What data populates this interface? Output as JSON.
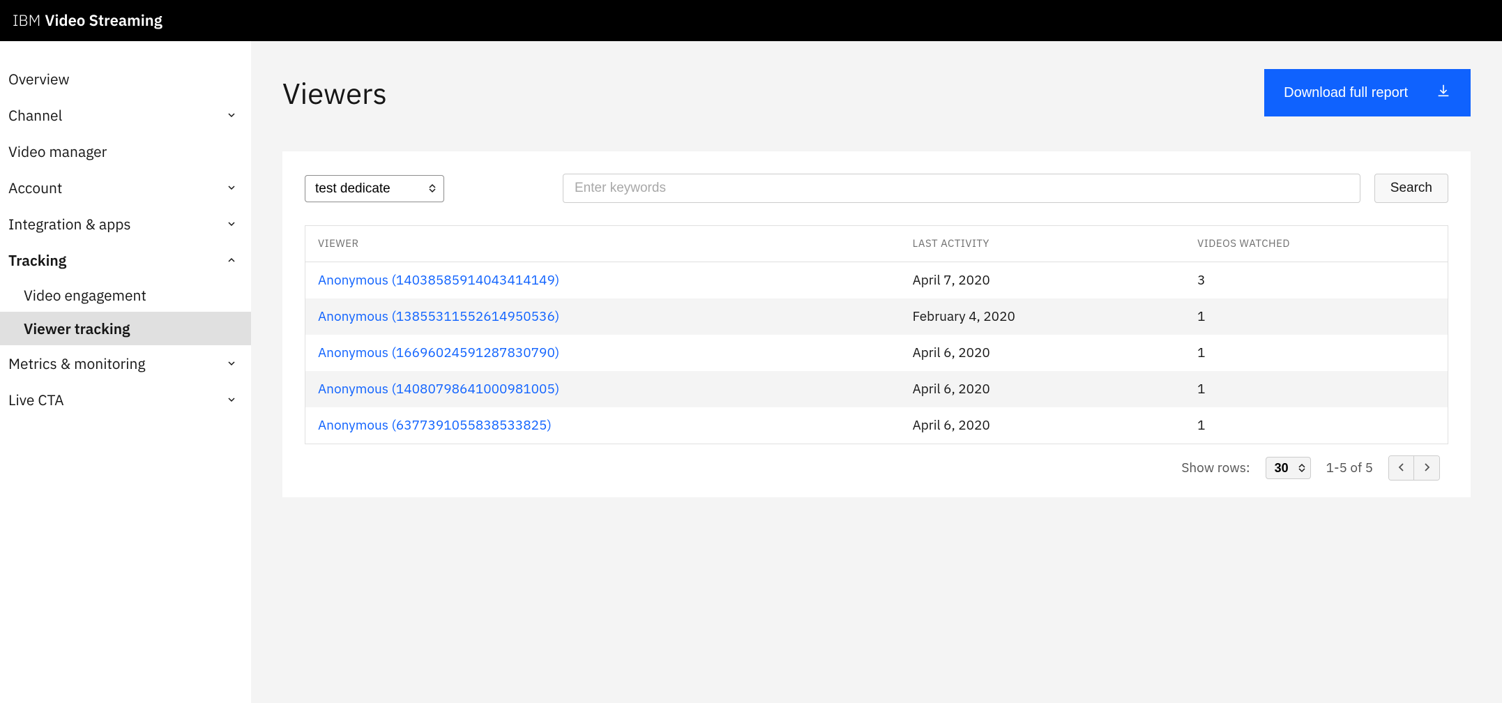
{
  "brand": {
    "prefix": "IBM",
    "name": "Video Streaming"
  },
  "sidebar": {
    "items": [
      {
        "label": "Overview",
        "hasCaret": false
      },
      {
        "label": "Channel",
        "hasCaret": true,
        "expanded": false
      },
      {
        "label": "Video manager",
        "hasCaret": false
      },
      {
        "label": "Account",
        "hasCaret": true,
        "expanded": false
      },
      {
        "label": "Integration & apps",
        "hasCaret": true,
        "expanded": false
      },
      {
        "label": "Tracking",
        "hasCaret": true,
        "expanded": true
      },
      {
        "label": "Metrics & monitoring",
        "hasCaret": true,
        "expanded": false
      },
      {
        "label": "Live CTA",
        "hasCaret": true,
        "expanded": false
      }
    ],
    "tracking_subitems": [
      {
        "label": "Video engagement",
        "active": false
      },
      {
        "label": "Viewer tracking",
        "active": true
      }
    ]
  },
  "page": {
    "title": "Viewers",
    "download_label": "Download full report"
  },
  "controls": {
    "filter_selected": "test dedicate",
    "keyword_placeholder": "Enter keywords",
    "search_label": "Search"
  },
  "table": {
    "headers": {
      "viewer": "VIEWER",
      "last_activity": "LAST ACTIVITY",
      "videos_watched": "VIDEOS WATCHED"
    },
    "rows": [
      {
        "viewer": "Anonymous (14038585914043414149)",
        "last_activity": "April 7, 2020",
        "videos_watched": "3"
      },
      {
        "viewer": "Anonymous (13855311552614950536)",
        "last_activity": "February 4, 2020",
        "videos_watched": "1"
      },
      {
        "viewer": "Anonymous (16696024591287830790)",
        "last_activity": "April 6, 2020",
        "videos_watched": "1"
      },
      {
        "viewer": "Anonymous (14080798641000981005)",
        "last_activity": "April 6, 2020",
        "videos_watched": "1"
      },
      {
        "viewer": "Anonymous (6377391055838533825)",
        "last_activity": "April 6, 2020",
        "videos_watched": "1"
      }
    ]
  },
  "footer": {
    "show_rows_label": "Show rows:",
    "rows_value": "30",
    "range_text": "1-5 of 5"
  }
}
